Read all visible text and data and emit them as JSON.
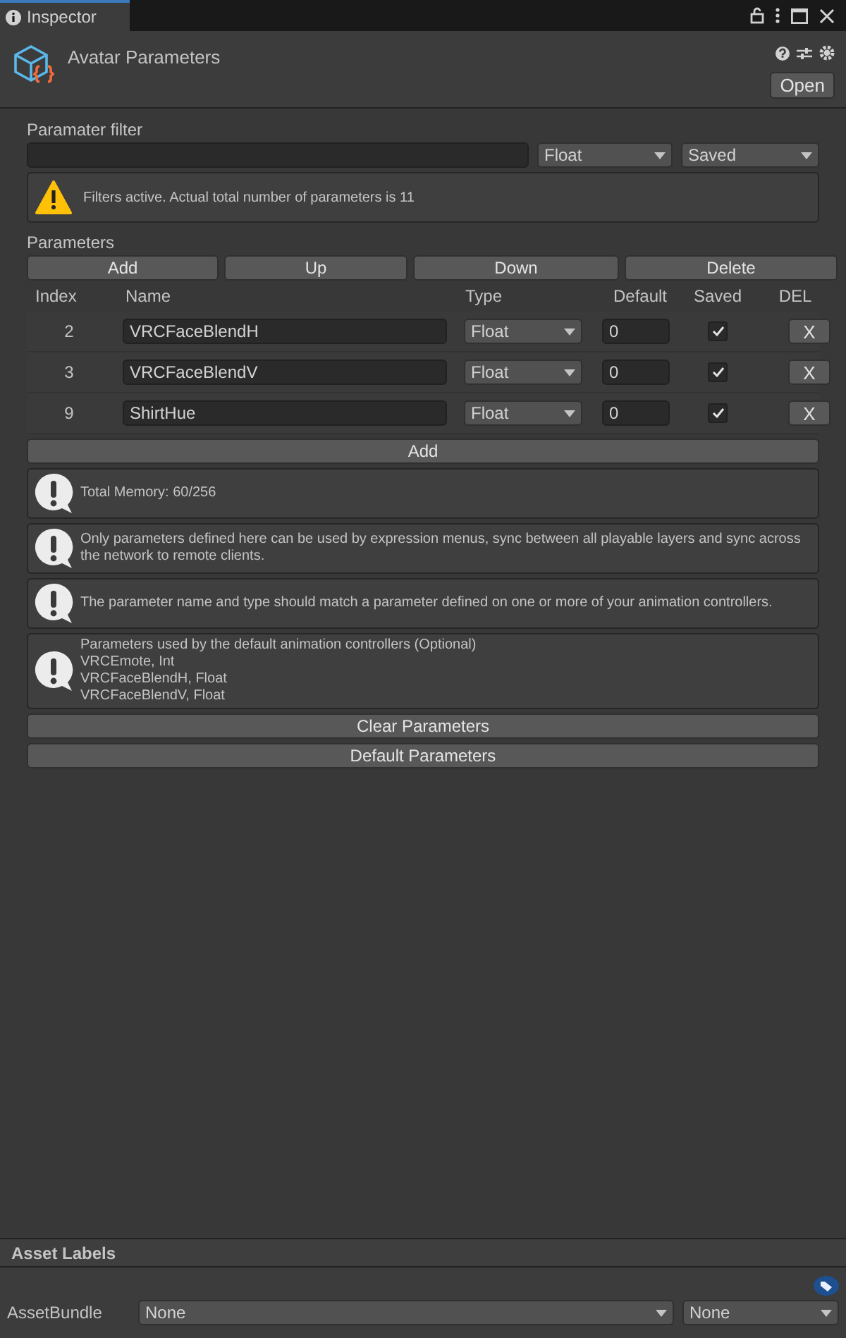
{
  "window": {
    "tab": "Inspector"
  },
  "header": {
    "title": "Avatar Parameters",
    "open_button": "Open"
  },
  "filter": {
    "label": "Paramater filter",
    "type": "Float",
    "saved": "Saved",
    "warning": "Filters active. Actual total number of parameters is 11"
  },
  "parameters": {
    "label": "Parameters",
    "buttons": [
      "Add",
      "Up",
      "Down",
      "Delete"
    ],
    "columns": [
      "Index",
      "Name",
      "Type",
      "Default",
      "Saved",
      "DEL"
    ],
    "rows": [
      {
        "index": "2",
        "name": "VRCFaceBlendH",
        "type": "Float",
        "default": "0",
        "saved": true,
        "del": "X"
      },
      {
        "index": "3",
        "name": "VRCFaceBlendV",
        "type": "Float",
        "default": "0",
        "saved": true,
        "del": "X"
      },
      {
        "index": "9",
        "name": "ShirtHue",
        "type": "Float",
        "default": "0",
        "saved": true,
        "del": "X"
      }
    ],
    "add_button": "Add"
  },
  "info_boxes": [
    {
      "lines": [
        "Total Memory: 60/256"
      ]
    },
    {
      "lines": [
        "Only parameters defined here can be used by expression menus, sync between all playable layers and sync across the network to remote clients."
      ]
    },
    {
      "lines": [
        "The parameter name and type should match a parameter defined on one or more of your animation controllers."
      ]
    },
    {
      "lines": [
        "Parameters used by the default animation controllers (Optional)",
        "VRCEmote, Int",
        "VRCFaceBlendH, Float",
        "VRCFaceBlendV, Float"
      ]
    }
  ],
  "actions": [
    "Clear Parameters",
    "Default Parameters"
  ],
  "asset_labels": {
    "title": "Asset Labels",
    "bundle_label": "AssetBundle",
    "bundle": "None",
    "variant": "None"
  }
}
